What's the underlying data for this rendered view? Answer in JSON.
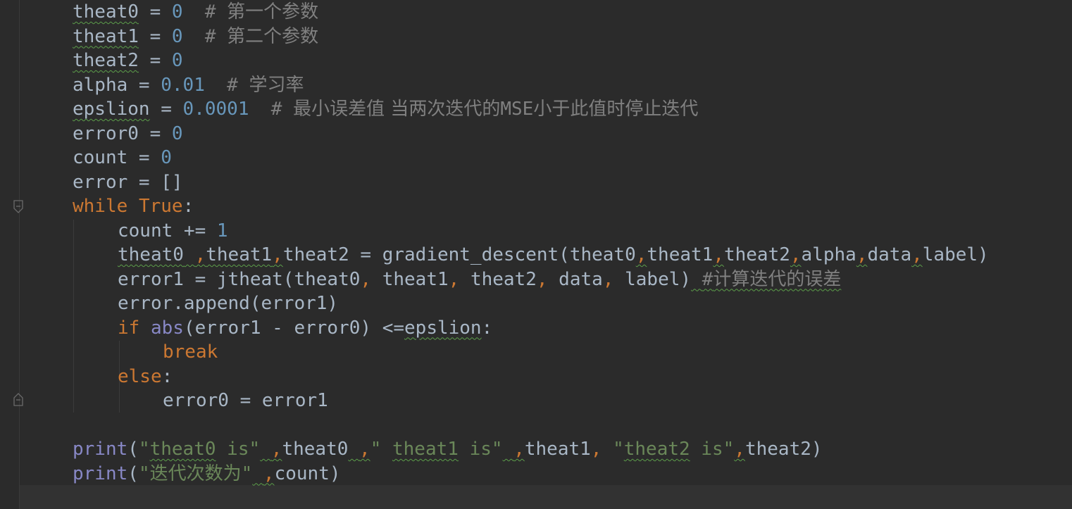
{
  "colors": {
    "background": "#2b2b2b",
    "identifier": "#a9b7c6",
    "number": "#6897bb",
    "keyword": "#cc7832",
    "builtin": "#8888c6",
    "string": "#6a8759",
    "comment": "#808080",
    "typo_underline": "#5c9e4a"
  },
  "icons": [
    "fold-start-icon",
    "fold-end-icon"
  ],
  "lines": [
    {
      "indent": 0,
      "tokens": [
        {
          "t": "theat0",
          "c": "id",
          "u": true
        },
        {
          "t": " = ",
          "c": "op"
        },
        {
          "t": "0",
          "c": "num"
        },
        {
          "t": "  # ",
          "c": "comment"
        },
        {
          "t": "第一个参数",
          "c": "comment",
          "cjk": true
        }
      ]
    },
    {
      "indent": 0,
      "tokens": [
        {
          "t": "theat1",
          "c": "id",
          "u": true
        },
        {
          "t": " = ",
          "c": "op"
        },
        {
          "t": "0",
          "c": "num"
        },
        {
          "t": "  # ",
          "c": "comment"
        },
        {
          "t": "第二个参数",
          "c": "comment",
          "cjk": true
        }
      ]
    },
    {
      "indent": 0,
      "tokens": [
        {
          "t": "theat2",
          "c": "id",
          "u": true
        },
        {
          "t": " = ",
          "c": "op"
        },
        {
          "t": "0",
          "c": "num"
        }
      ]
    },
    {
      "indent": 0,
      "tokens": [
        {
          "t": "alpha",
          "c": "id"
        },
        {
          "t": " = ",
          "c": "op"
        },
        {
          "t": "0.01",
          "c": "num"
        },
        {
          "t": "  # ",
          "c": "comment"
        },
        {
          "t": "学习率",
          "c": "comment",
          "cjk": true
        }
      ]
    },
    {
      "indent": 0,
      "tokens": [
        {
          "t": "epslion",
          "c": "id",
          "u": true
        },
        {
          "t": " = ",
          "c": "op"
        },
        {
          "t": "0.0001",
          "c": "num"
        },
        {
          "t": "  # ",
          "c": "comment"
        },
        {
          "t": "最小误差值 当两次迭代的",
          "c": "comment",
          "cjk": true
        },
        {
          "t": "MSE",
          "c": "comment"
        },
        {
          "t": "小于此值时停止迭代",
          "c": "comment",
          "cjk": true
        }
      ]
    },
    {
      "indent": 0,
      "tokens": [
        {
          "t": "error0",
          "c": "id"
        },
        {
          "t": " = ",
          "c": "op"
        },
        {
          "t": "0",
          "c": "num"
        }
      ]
    },
    {
      "indent": 0,
      "tokens": [
        {
          "t": "count",
          "c": "id"
        },
        {
          "t": " = ",
          "c": "op"
        },
        {
          "t": "0",
          "c": "num"
        }
      ]
    },
    {
      "indent": 0,
      "tokens": [
        {
          "t": "error",
          "c": "id"
        },
        {
          "t": " = ",
          "c": "op"
        },
        {
          "t": "[]",
          "c": "op"
        }
      ]
    },
    {
      "indent": 0,
      "tokens": [
        {
          "t": "while",
          "c": "kw"
        },
        {
          "t": " ",
          "c": "op"
        },
        {
          "t": "True",
          "c": "kw"
        },
        {
          "t": ":",
          "c": "op"
        }
      ]
    },
    {
      "indent": 1,
      "tokens": [
        {
          "t": "count",
          "c": "id"
        },
        {
          "t": " += ",
          "c": "op"
        },
        {
          "t": "1",
          "c": "num"
        }
      ]
    },
    {
      "indent": 1,
      "tokens": [
        {
          "t": "theat0",
          "c": "id",
          "u": true
        },
        {
          "t": " ",
          "c": "op",
          "u": true
        },
        {
          "t": ",",
          "c": "punct",
          "u": true
        },
        {
          "t": "theat1",
          "c": "id",
          "u": true
        },
        {
          "t": ",",
          "c": "punct",
          "u": true
        },
        {
          "t": "theat2",
          "c": "id"
        },
        {
          "t": " = ",
          "c": "op"
        },
        {
          "t": "gradient_descent(",
          "c": "id"
        },
        {
          "t": "theat0",
          "c": "id"
        },
        {
          "t": ",",
          "c": "punct",
          "u": true
        },
        {
          "t": "theat1",
          "c": "id"
        },
        {
          "t": ",",
          "c": "punct",
          "u": true
        },
        {
          "t": "theat2",
          "c": "id"
        },
        {
          "t": ",",
          "c": "punct",
          "u": true
        },
        {
          "t": "alpha",
          "c": "id"
        },
        {
          "t": ",",
          "c": "punct",
          "u": true
        },
        {
          "t": "data",
          "c": "id"
        },
        {
          "t": ",",
          "c": "punct",
          "u": true
        },
        {
          "t": "label)",
          "c": "id"
        }
      ]
    },
    {
      "indent": 1,
      "tokens": [
        {
          "t": "error1",
          "c": "id"
        },
        {
          "t": " = ",
          "c": "op"
        },
        {
          "t": "jtheat(theat0",
          "c": "id"
        },
        {
          "t": ", ",
          "c": "punct"
        },
        {
          "t": "theat1",
          "c": "id"
        },
        {
          "t": ", ",
          "c": "punct"
        },
        {
          "t": "theat2",
          "c": "id"
        },
        {
          "t": ", ",
          "c": "punct"
        },
        {
          "t": "data",
          "c": "id"
        },
        {
          "t": ", ",
          "c": "punct"
        },
        {
          "t": "label)",
          "c": "id"
        },
        {
          "t": " ",
          "c": "op",
          "u": true
        },
        {
          "t": "#",
          "c": "comment",
          "u": true
        },
        {
          "t": "计算迭代的误差",
          "c": "comment",
          "cjk": true,
          "u": true
        }
      ]
    },
    {
      "indent": 1,
      "tokens": [
        {
          "t": "error.append(error1)",
          "c": "id"
        }
      ]
    },
    {
      "indent": 1,
      "tokens": [
        {
          "t": "if",
          "c": "kw"
        },
        {
          "t": " ",
          "c": "op"
        },
        {
          "t": "abs",
          "c": "builtin"
        },
        {
          "t": "(error1 - error0) <=",
          "c": "op"
        },
        {
          "t": "epslion",
          "c": "id",
          "u": true
        },
        {
          "t": ":",
          "c": "op"
        }
      ]
    },
    {
      "indent": 2,
      "tokens": [
        {
          "t": "break",
          "c": "kw"
        }
      ]
    },
    {
      "indent": 1,
      "tokens": [
        {
          "t": "else",
          "c": "kw"
        },
        {
          "t": ":",
          "c": "op"
        }
      ]
    },
    {
      "indent": 2,
      "tokens": [
        {
          "t": "error0 = error1",
          "c": "id"
        }
      ]
    },
    {
      "indent": 0,
      "tokens": []
    },
    {
      "indent": 0,
      "tokens": [
        {
          "t": "print",
          "c": "builtin"
        },
        {
          "t": "(",
          "c": "op"
        },
        {
          "t": "\"",
          "c": "str"
        },
        {
          "t": "theat0",
          "c": "str",
          "u": true
        },
        {
          "t": " is\"",
          "c": "str"
        },
        {
          "t": " ",
          "c": "op",
          "u": true
        },
        {
          "t": ",",
          "c": "punct",
          "u": true
        },
        {
          "t": "theat0",
          "c": "id"
        },
        {
          "t": " ",
          "c": "op",
          "u": true
        },
        {
          "t": ",",
          "c": "punct",
          "u": true
        },
        {
          "t": "\" ",
          "c": "str"
        },
        {
          "t": "theat1",
          "c": "str",
          "u": true
        },
        {
          "t": " is\"",
          "c": "str"
        },
        {
          "t": " ",
          "c": "op",
          "u": true
        },
        {
          "t": ",",
          "c": "punct",
          "u": true
        },
        {
          "t": "theat1",
          "c": "id"
        },
        {
          "t": ", ",
          "c": "punct"
        },
        {
          "t": "\"",
          "c": "str"
        },
        {
          "t": "theat2",
          "c": "str",
          "u": true
        },
        {
          "t": " is\"",
          "c": "str"
        },
        {
          "t": ",",
          "c": "punct",
          "u": true
        },
        {
          "t": "theat2)",
          "c": "id"
        }
      ]
    },
    {
      "indent": 0,
      "tokens": [
        {
          "t": "print",
          "c": "builtin"
        },
        {
          "t": "(",
          "c": "op"
        },
        {
          "t": "\"",
          "c": "str"
        },
        {
          "t": "迭代次数为",
          "c": "str",
          "cjk": true
        },
        {
          "t": "\"",
          "c": "str"
        },
        {
          "t": " ",
          "c": "op",
          "u": true
        },
        {
          "t": ",",
          "c": "punct",
          "u": true
        },
        {
          "t": "count)",
          "c": "id"
        }
      ]
    }
  ]
}
